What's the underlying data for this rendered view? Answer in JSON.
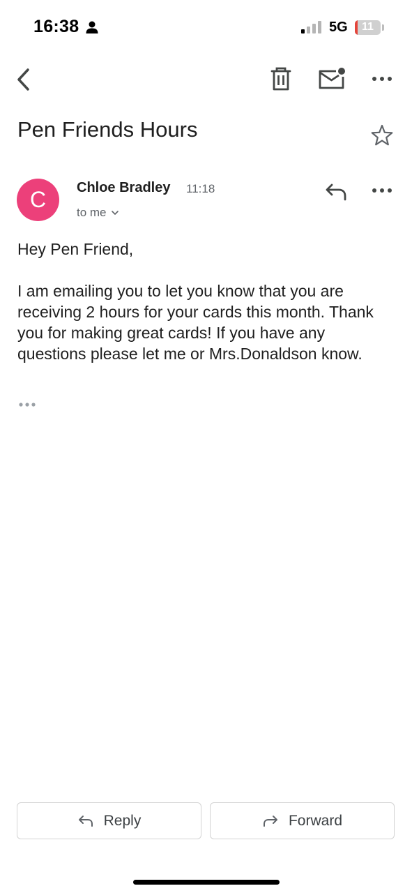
{
  "status_bar": {
    "time": "16:38",
    "network": "5G",
    "battery": "11",
    "battery_level": 0.11
  },
  "toolbar": {
    "icons": [
      "back-icon",
      "trash-icon",
      "mail-unread-icon",
      "more-icon"
    ]
  },
  "email": {
    "subject": "Pen Friends Hours",
    "sender": "Chloe Bradley",
    "avatar_initial": "C",
    "avatar_color": "#ec407a",
    "time": "11:18",
    "recipient": "to me",
    "greeting": "Hey Pen Friend,",
    "body": "I am emailing you to let you know that you are receiving 2 hours for your cards this month. Thank you for making great cards! If you have any questions please let me or Mrs.Donaldson know."
  },
  "actions": {
    "reply_label": "Reply",
    "forward_label": "Forward"
  }
}
